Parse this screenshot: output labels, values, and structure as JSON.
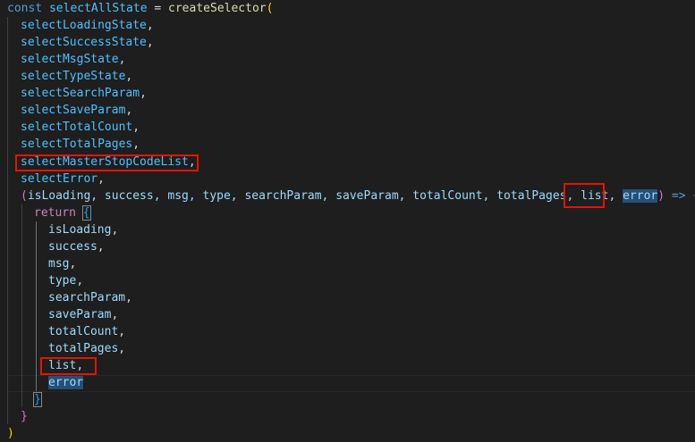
{
  "code": {
    "l1": {
      "kw": "const",
      "name": "selectAllState",
      "op": " = ",
      "fn": "createSelector",
      "open": "("
    },
    "l2": {
      "arg": "selectLoadingState",
      "comma": ","
    },
    "l3": {
      "arg": "selectSuccessState",
      "comma": ","
    },
    "l4": {
      "arg": "selectMsgState",
      "comma": ","
    },
    "l5": {
      "arg": "selectTypeState",
      "comma": ","
    },
    "l6": {
      "arg": "selectSearchParam",
      "comma": ","
    },
    "l7": {
      "arg": "selectSaveParam",
      "comma": ","
    },
    "l8": {
      "arg": "selectTotalCount",
      "comma": ","
    },
    "l9": {
      "arg": "selectTotalPages",
      "comma": ","
    },
    "l10": {
      "arg": "selectMasterStopCodeList",
      "comma": ","
    },
    "l11": {
      "arg": "selectError",
      "comma": ","
    },
    "l12": {
      "open": "(",
      "params": "isLoading, success, msg, type, searchParam, saveParam, totalCount, totalPages, ",
      "p_list": "list",
      "sep": ", ",
      "p_error": "error",
      "close": ")",
      "arrow": " => ",
      "brace": "{"
    },
    "l13": {
      "kw": "return",
      "brace": "{"
    },
    "l14": {
      "prop": "isLoading",
      "comma": ","
    },
    "l15": {
      "prop": "success",
      "comma": ","
    },
    "l16": {
      "prop": "msg",
      "comma": ","
    },
    "l17": {
      "prop": "type",
      "comma": ","
    },
    "l18": {
      "prop": "searchParam",
      "comma": ","
    },
    "l19": {
      "prop": "saveParam",
      "comma": ","
    },
    "l20": {
      "prop": "totalCount",
      "comma": ","
    },
    "l21": {
      "prop": "totalPages",
      "comma": ","
    },
    "l22": {
      "prop": "list",
      "comma": ","
    },
    "l23": {
      "prop": "error"
    },
    "l24": {
      "brace": "}"
    },
    "l25": {
      "brace": "}"
    },
    "l26": {
      "paren": ")"
    }
  },
  "colors": {
    "background": "#1e1e1e",
    "keyword": "#569cd6",
    "return_keyword": "#c586c0",
    "variable": "#9cdcfe",
    "constant": "#4fc1ff",
    "function": "#dcdcaa",
    "bracket_1": "#ffd700",
    "bracket_2": "#da70d6",
    "bracket_3": "#179fff",
    "annotation": "#e51400"
  }
}
